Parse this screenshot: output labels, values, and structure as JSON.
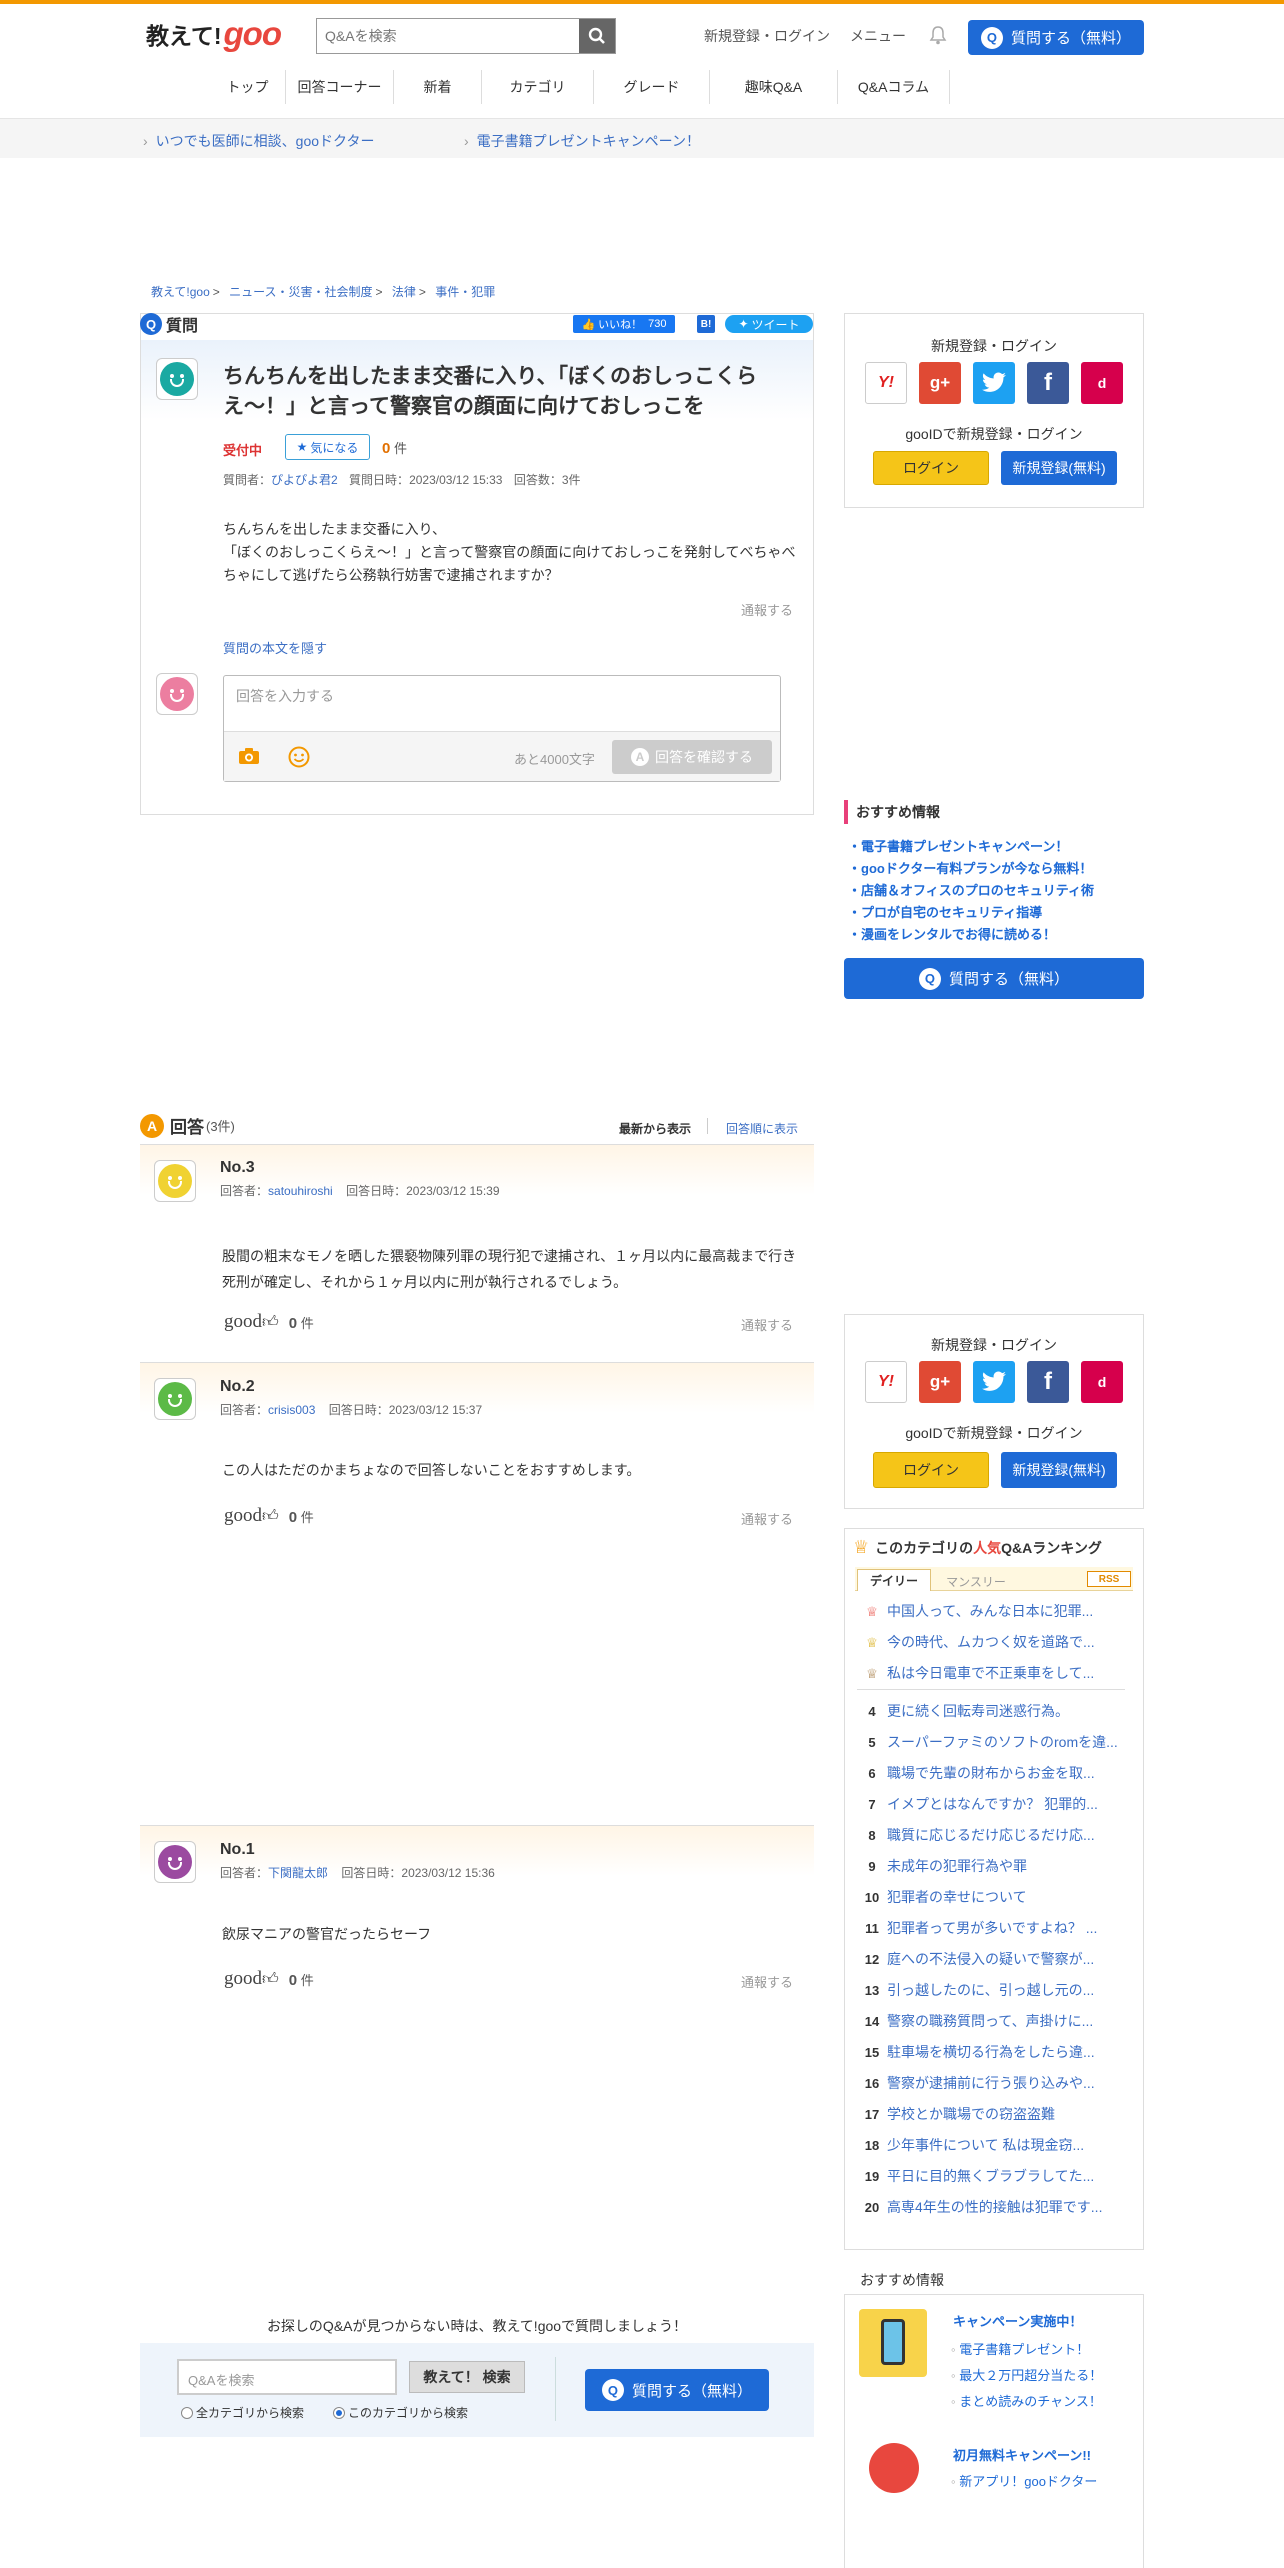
{
  "header": {
    "logo_jp": "教えて!",
    "logo_goo": "goo",
    "search_placeholder": "Q&Aを検索",
    "register_login": "新規登録・ログイン",
    "menu": "メニュー",
    "ask_button": "質問する（無料）"
  },
  "nav": [
    "トップ",
    "回答コーナー",
    "新着",
    "カテゴリ",
    "グレード",
    "趣味Q&A",
    "Q&Aコラム"
  ],
  "promo_links": [
    "いつでも医師に相談、gooドクター",
    "電子書籍プレゼントキャンペーン！"
  ],
  "breadcrumb": [
    "教えて!goo",
    "ニュース・災害・社会制度",
    "法律",
    "事件・犯罪"
  ],
  "question": {
    "section_label": "質問",
    "like_label": "いいね！",
    "like_count": "730",
    "hatena": "B!",
    "tweet": "ツイート",
    "title": "ちんちんを出したまま交番に入り、「ぼくのおしっこくらえ〜！」と言って警察官の顔面に向けておしっこを",
    "status": "受付中",
    "kininaru": "気になる",
    "kininaru_count": "0",
    "kininaru_unit": "件",
    "asker_label": "質問者：",
    "asker": "ぴよぴよ君2",
    "date_label": "質問日時：",
    "date": "2023/03/12 15:33",
    "answer_count_label": "回答数：3件",
    "body_lines": [
      "ちんちんを出したまま交番に入り、",
      "「ぼくのおしっこくらえ〜！」と言って警察官の顔面に向けておしっこを発射してべちゃべちゃにして逃げたら公務執行妨害で逮捕されますか？"
    ],
    "report": "通報する",
    "hide_body": "質問の本文を隠す",
    "answer_placeholder": "回答を入力する",
    "chars_left": "あと4000文字",
    "confirm_button": "回答を確認する"
  },
  "sidebar_login": {
    "title": "新規登録・ログイン",
    "gooid": "gooIDで新規登録・ログイン",
    "login": "ログイン",
    "register": "新規登録(無料)",
    "sns": [
      "Y!",
      "g+",
      "twitter",
      "f",
      "d"
    ]
  },
  "recommend": {
    "title": "おすすめ情報",
    "items": [
      "電子書籍プレゼントキャンペーン！",
      "gooドクター有料プランが今なら無料！",
      "店舗＆オフィスのプロのセキュリティ術",
      "プロが自宅のセキュリティ指導",
      "漫画をレンタルでお得に読める！"
    ],
    "ask_button": "質問する（無料）"
  },
  "answers_header": {
    "title": "回答",
    "count": "(3件)",
    "sort_latest": "最新から表示",
    "sort_order": "回答順に表示"
  },
  "answers": [
    {
      "no": "No.3",
      "answerer_label": "回答者：",
      "answerer": "satouhiroshi",
      "date_label": "回答日時：",
      "date": "2023/03/12 15:39",
      "body": "股間の粗末なモノを晒した猥褻物陳列罪の現行犯で逮捕され、１ヶ月以内に最高裁まで行き死刑が確定し、それから１ヶ月以内に刑が執行されるでしょう。",
      "good": "good",
      "count": "0",
      "unit": "件",
      "report": "通報する"
    },
    {
      "no": "No.2",
      "answerer_label": "回答者：",
      "answerer": "crisis003",
      "date_label": "回答日時：",
      "date": "2023/03/12 15:37",
      "body": "この人はただのかまちょなので回答しないことをおすすめします。",
      "good": "good",
      "count": "0",
      "unit": "件",
      "report": "通報する"
    },
    {
      "no": "No.1",
      "answerer_label": "回答者：",
      "answerer": "下関龍太郎",
      "date_label": "回答日時：",
      "date": "2023/03/12 15:36",
      "body": "飲尿マニアの警官だったらセーフ",
      "good": "good",
      "count": "0",
      "unit": "件",
      "report": "通報する"
    }
  ],
  "ranking": {
    "title_pre": "このカテゴリの",
    "title_hl": "人気",
    "title_post": "Q&Aランキング",
    "tab_daily": "デイリー",
    "tab_monthly": "マンスリー",
    "rss": "RSS",
    "items": [
      "中国人って、みんな日本に犯罪...",
      "今の時代、ムカつく奴を道路で...",
      "私は今日電車で不正乗車をして...",
      "更に続く回転寿司迷惑行為。",
      "スーパーファミのソフトのromを違...",
      "職場で先輩の財布からお金を取...",
      "イメプとはなんですか？ 犯罪的...",
      "職質に応じるだけ応じるだけ応...",
      "未成年の犯罪行為や罪",
      "犯罪者の幸せについて",
      "犯罪者って男が多いですよね？ ...",
      "庭への不法侵入の疑いで警察が...",
      "引っ越したのに、引っ越し元の...",
      "警察の職務質問って、声掛けに...",
      "駐車場を横切る行為をしたら違...",
      "警察が逮捕前に行う張り込みや...",
      "学校とか職場での窃盗盗難",
      "少年事件について 私は現金窃...",
      "平日に目的無くブラブラしてた...",
      "高専4年生の性的接触は犯罪です..."
    ]
  },
  "bottom": {
    "prompt": "お探しのQ&Aが見つからない時は、教えて!gooで質問しましょう！",
    "search_placeholder": "Q&Aを検索",
    "search_button": "教えて！ 検索",
    "radio_all": "全カテゴリから検索",
    "radio_this": "このカテゴリから検索",
    "ask_button": "質問する（無料）"
  },
  "side_recommend": {
    "title": "おすすめ情報",
    "campaign1_title": "キャンペーン実施中！",
    "campaign1_items": [
      "電子書籍プレゼント！",
      "最大２万円超分当たる！",
      "まとめ読みのチャンス！"
    ],
    "campaign2_title": "初月無料キャンペーン!!",
    "campaign2_items": [
      "新アプリ！gooドクター"
    ]
  },
  "colors": {
    "accent": "#1e6ad6",
    "brand_orange": "#f39800",
    "logo_red": "#e8473e"
  }
}
